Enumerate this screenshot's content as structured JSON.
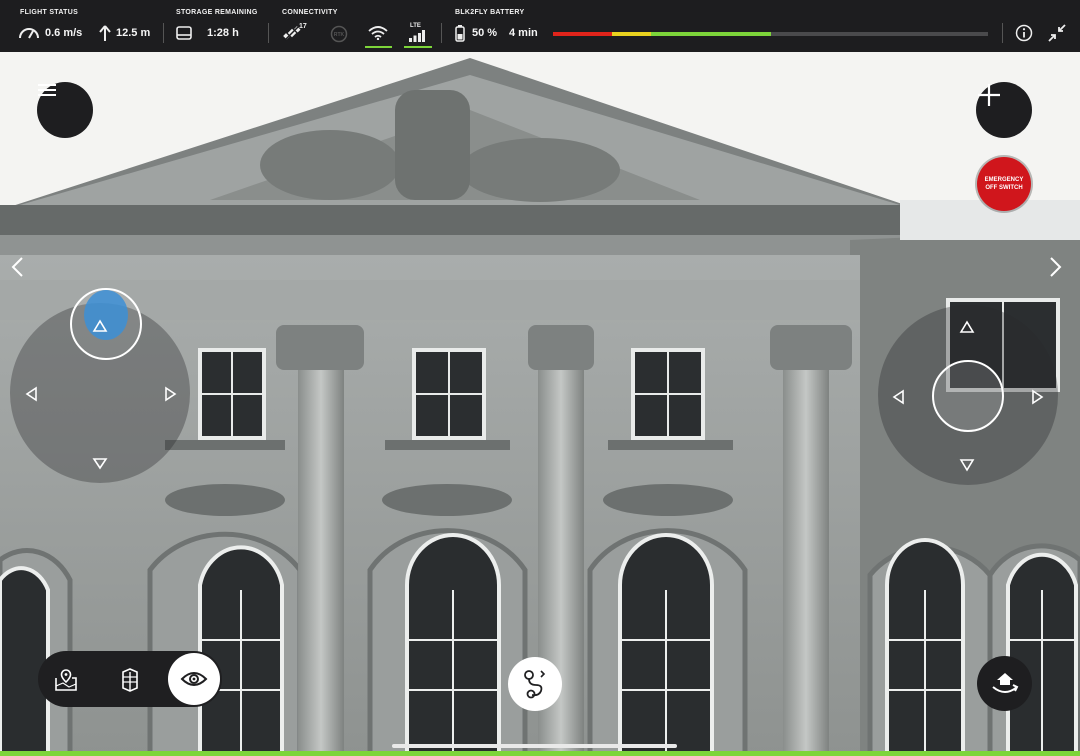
{
  "flight_status": {
    "label": "FLIGHT STATUS",
    "speed": "0.6 m/s",
    "altitude": "12.5 m",
    "speed_icon": "speedometer-icon",
    "altitude_icon": "altitude-arrow-icon"
  },
  "storage": {
    "label": "STORAGE REMAINING",
    "value": "1:28 h",
    "icon": "storage-drive-icon"
  },
  "connectivity": {
    "label": "CONNECTIVITY",
    "satellites": "17",
    "lte_label": "LTE",
    "icons": [
      "satellite-icon",
      "rtk-icon",
      "wifi-icon",
      "lte-signal-icon"
    ]
  },
  "battery": {
    "label": "BLK2FLY BATTERY",
    "percent": "50 %",
    "time": "4 min",
    "level": 0.5,
    "colors": {
      "red": "#e0241b",
      "yellow": "#e9d21f",
      "green": "#7dd53a",
      "track": "#4a4a4c"
    }
  },
  "topbar_icons": [
    "info-icon",
    "collapse-icon"
  ],
  "emergency": {
    "line1": "EMERGENCY",
    "line2": "OFF SWITCH",
    "color": "#d0161c"
  },
  "toolbar": {
    "tools": [
      "map-pin-icon",
      "building-scan-icon",
      "eye-icon"
    ],
    "active": "eye-icon"
  },
  "accent_color": "#7dd53a"
}
